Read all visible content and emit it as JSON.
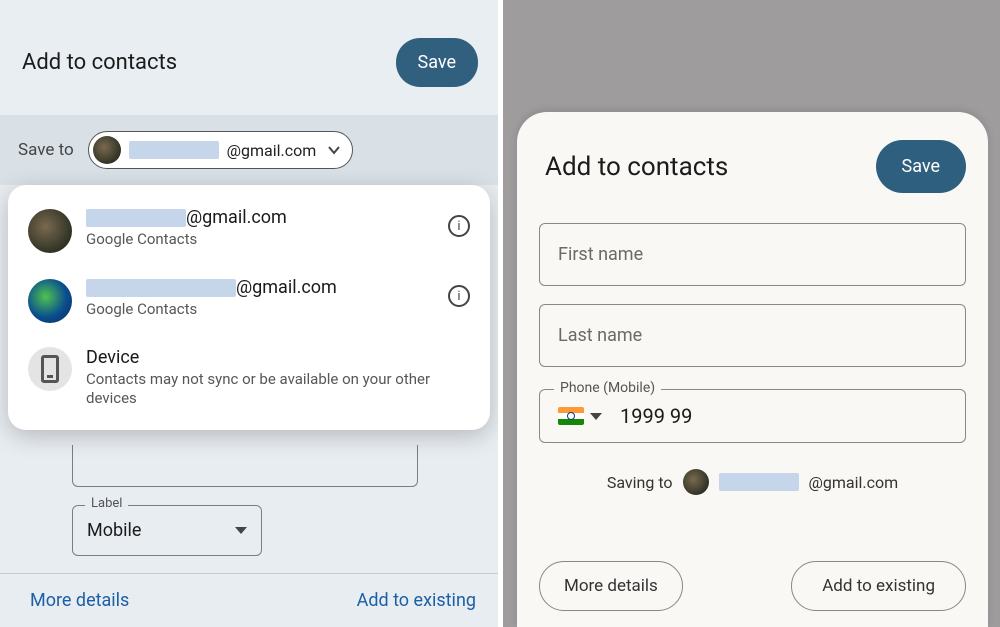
{
  "left": {
    "title": "Add to contacts",
    "save_label": "Save",
    "save_to_label": "Save to",
    "chip_email_suffix": "@gmail.com",
    "dropdown": {
      "item1_suffix": "@gmail.com",
      "item1_sub": "Google Contacts",
      "item2_suffix": "@gmail.com",
      "item2_sub": "Google Contacts",
      "device_title": "Device",
      "device_sub": "Contacts may not sync or be available on your other devices"
    },
    "label_float": "Label",
    "label_value": "Mobile",
    "more_details": "More details",
    "add_to_existing": "Add to existing"
  },
  "right": {
    "title": "Add to contacts",
    "save_label": "Save",
    "first_name_ph": "First name",
    "last_name_ph": "Last name",
    "phone_float": "Phone (Mobile)",
    "phone_value": "1999 99",
    "saving_to": "Saving to",
    "saving_email_suffix": "@gmail.com",
    "more_details": "More details",
    "add_to_existing": "Add to existing"
  }
}
